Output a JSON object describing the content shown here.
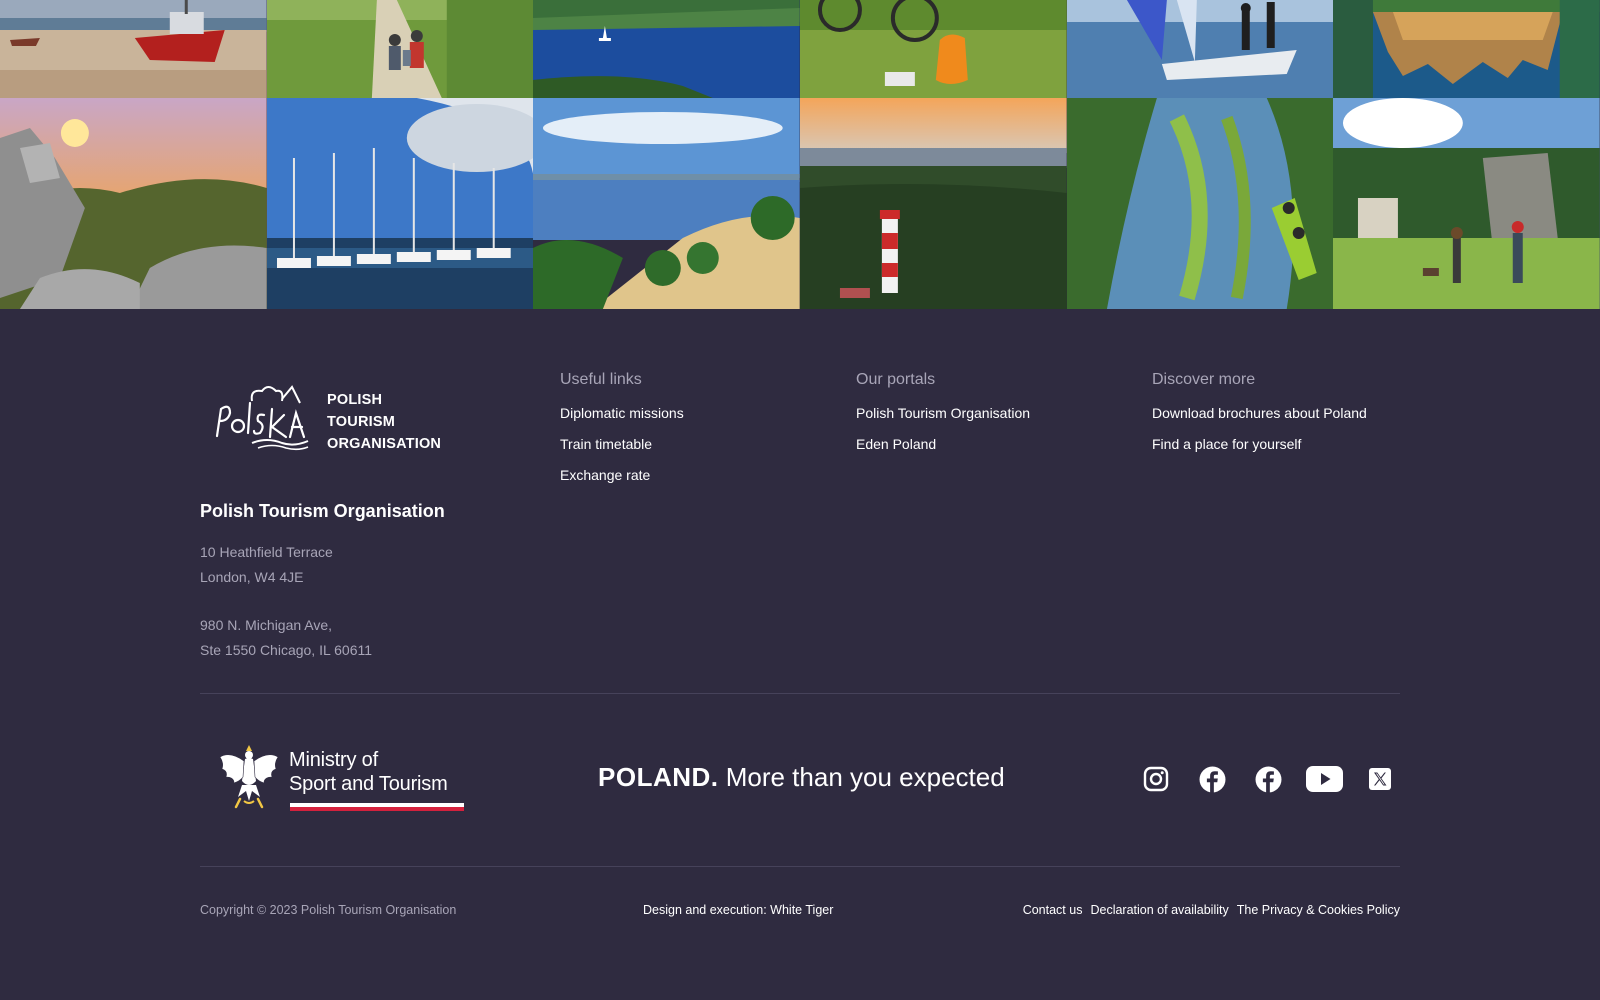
{
  "photos": [
    {
      "name": "beach-fishing-boat"
    },
    {
      "name": "hikers-on-path"
    },
    {
      "name": "lake-with-sailboat"
    },
    {
      "name": "bicycle-and-backpack"
    },
    {
      "name": "catamaran-sailing"
    },
    {
      "name": "castle-reflection"
    },
    {
      "name": "rocks-at-sunset"
    },
    {
      "name": "marina-sailboats"
    },
    {
      "name": "lake-beach"
    },
    {
      "name": "lighthouse-forest"
    },
    {
      "name": "kayak-on-river"
    },
    {
      "name": "hikers-in-meadow"
    }
  ],
  "brand": {
    "logo_line1": "POLISH",
    "logo_line2": "TOURISM",
    "logo_line3": "ORGANISATION",
    "org_name": "Polish Tourism Organisation",
    "address_london_line1": "10 Heathfield Terrace",
    "address_london_line2": "London, W4 4JE",
    "address_chicago_line1": "980 N. Michigan Ave,",
    "address_chicago_line2": "Ste 1550 Chicago, IL 60611"
  },
  "columns": {
    "useful": {
      "title": "Useful links",
      "items": [
        "Diplomatic missions",
        "Train timetable",
        "Exchange rate"
      ]
    },
    "portals": {
      "title": "Our portals",
      "items": [
        "Polish Tourism Organisation",
        "Eden Poland"
      ]
    },
    "discover": {
      "title": "Discover more",
      "items": [
        "Download brochures about Poland",
        "Find a place for yourself"
      ]
    }
  },
  "ministry": {
    "line1": "Ministry of",
    "line2": "Sport and Tourism"
  },
  "tagline": {
    "bold": "POLAND.",
    "rest": " More than you expected"
  },
  "social": {
    "icons": [
      "instagram-icon",
      "facebook-icon",
      "facebook-icon",
      "youtube-icon",
      "x-icon"
    ]
  },
  "bottom": {
    "copyright": "Copyright © 2023 Polish Tourism Organisation",
    "credits": "Design and execution: White Tiger",
    "legal": [
      "Contact us",
      "Declaration of availability",
      "The Privacy & Cookies Policy"
    ]
  },
  "colors": {
    "background": "#2f2b40",
    "muted_text": "#a8a5b7",
    "divider": "#46425a",
    "flag_red": "#d4213d"
  }
}
